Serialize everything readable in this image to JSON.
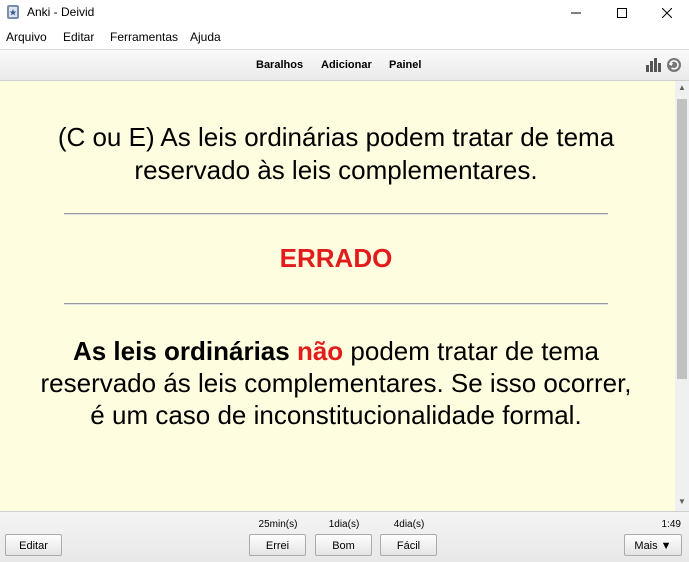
{
  "window": {
    "title": "Anki - Deivid"
  },
  "menu": {
    "items": [
      "Arquivo",
      "Editar",
      "Ferramentas",
      "Ajuda"
    ]
  },
  "toolbar": {
    "links": [
      "Baralhos",
      "Adicionar",
      "Painel"
    ]
  },
  "card": {
    "question": "(C ou E) As leis ordinárias podem tratar de tema reservado às leis complementares.",
    "verdict": "ERRADO",
    "answer_bold": "As leis ordinárias",
    "answer_red": "não",
    "answer_rest": " podem tratar de tema reservado ás leis complementares. Se isso ocorrer, é um caso de inconstitucionalidade formal."
  },
  "bottom": {
    "edit_label": "Editar",
    "intervals": [
      "25min(s)",
      "1dia(s)",
      "4dia(s)"
    ],
    "answer_buttons": [
      "Errei",
      "Bom",
      "Fácil"
    ],
    "more_label": "Mais ▼",
    "timer": "1:49"
  },
  "colors": {
    "card_bg": "#fffddf",
    "verdict": "#e21c1c"
  }
}
